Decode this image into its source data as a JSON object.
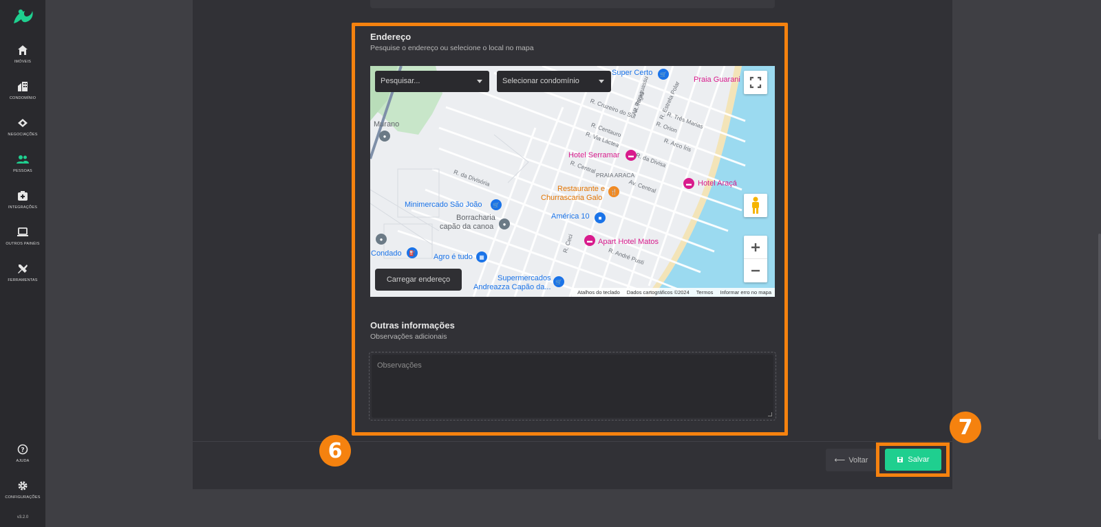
{
  "app": {
    "version": "v3.2.0",
    "accent": "#1fcf8f",
    "highlight": "#f5820f"
  },
  "sidebar": {
    "items": [
      {
        "label": "IMÓVEIS",
        "icon": "home-icon"
      },
      {
        "label": "CONDOMÍNIO",
        "icon": "building-icon"
      },
      {
        "label": "NEGOCIAÇÕES",
        "icon": "handshake-icon"
      },
      {
        "label": "PESSOAS",
        "icon": "people-icon"
      },
      {
        "label": "INTEGRAÇÕES",
        "icon": "integration-icon"
      },
      {
        "label": "OUTROS PAINÉIS",
        "icon": "laptop-icon"
      },
      {
        "label": "FERRAMENTAS",
        "icon": "tools-icon"
      }
    ],
    "bottom": [
      {
        "label": "AJUDA",
        "icon": "help-icon"
      },
      {
        "label": "CONFIGURAÇÕES",
        "icon": "gear-icon"
      }
    ]
  },
  "address": {
    "title": "Endereço",
    "subtitle": "Pesquise o endereço ou selecione o local no mapa",
    "search_placeholder": "Pesquisar...",
    "condo_placeholder": "Selecionar condomínio",
    "load_button": "Carregar endereço"
  },
  "map": {
    "places": {
      "super_certo": "Super Certo",
      "praia_guarani": "Praia Guarani",
      "murano": "Murano",
      "hotel_serramar": "Hotel Serramar",
      "hotel_araca": "Hotel Araçá",
      "restaurante_1": "Restaurante e",
      "restaurante_2": "Churrascaria Galo",
      "minimercado": "Minimercado São João",
      "borracharia_1": "Borracharia",
      "borracharia_2": "capão da canoa",
      "america": "América 10",
      "apart": "Apart Hotel Matos",
      "condado": "Condado",
      "agro": "Agro é tudo",
      "super_1": "Supermercados",
      "super_2": "Andreazza Capão da..."
    },
    "streets": {
      "paraguassu": "Av. Paraguassu",
      "rigel": "R. Rigel",
      "estrela_polar": "R. Estrela Polar",
      "cruzeiro": "R. Cruzeiro do Sul",
      "tres_marias": "R. Três Marias",
      "orion": "R. Orion",
      "centauro": "R. Centauro",
      "via_lactea": "R. Via Láctea",
      "arco_iris": "R. Arco Íris",
      "da_divisa": "R. da Divisa",
      "central": "R. Central",
      "praia_araca": "PRAIA ARACA",
      "av_central": "Av. Central",
      "divisoria": "R. da Divisória",
      "ceci": "R. Ceci",
      "andre_pusti": "R. André Pusti"
    },
    "attribution": [
      "Atalhos do teclado",
      "Dados cartográficos ©2024",
      "Termos",
      "Informar erro no mapa"
    ]
  },
  "other": {
    "title": "Outras informações",
    "subtitle": "Observações adicionais",
    "obs_placeholder": "Observações"
  },
  "footer": {
    "back_label": "Voltar",
    "save_label": "Salvar"
  },
  "steps": {
    "six": "6",
    "seven": "7"
  }
}
